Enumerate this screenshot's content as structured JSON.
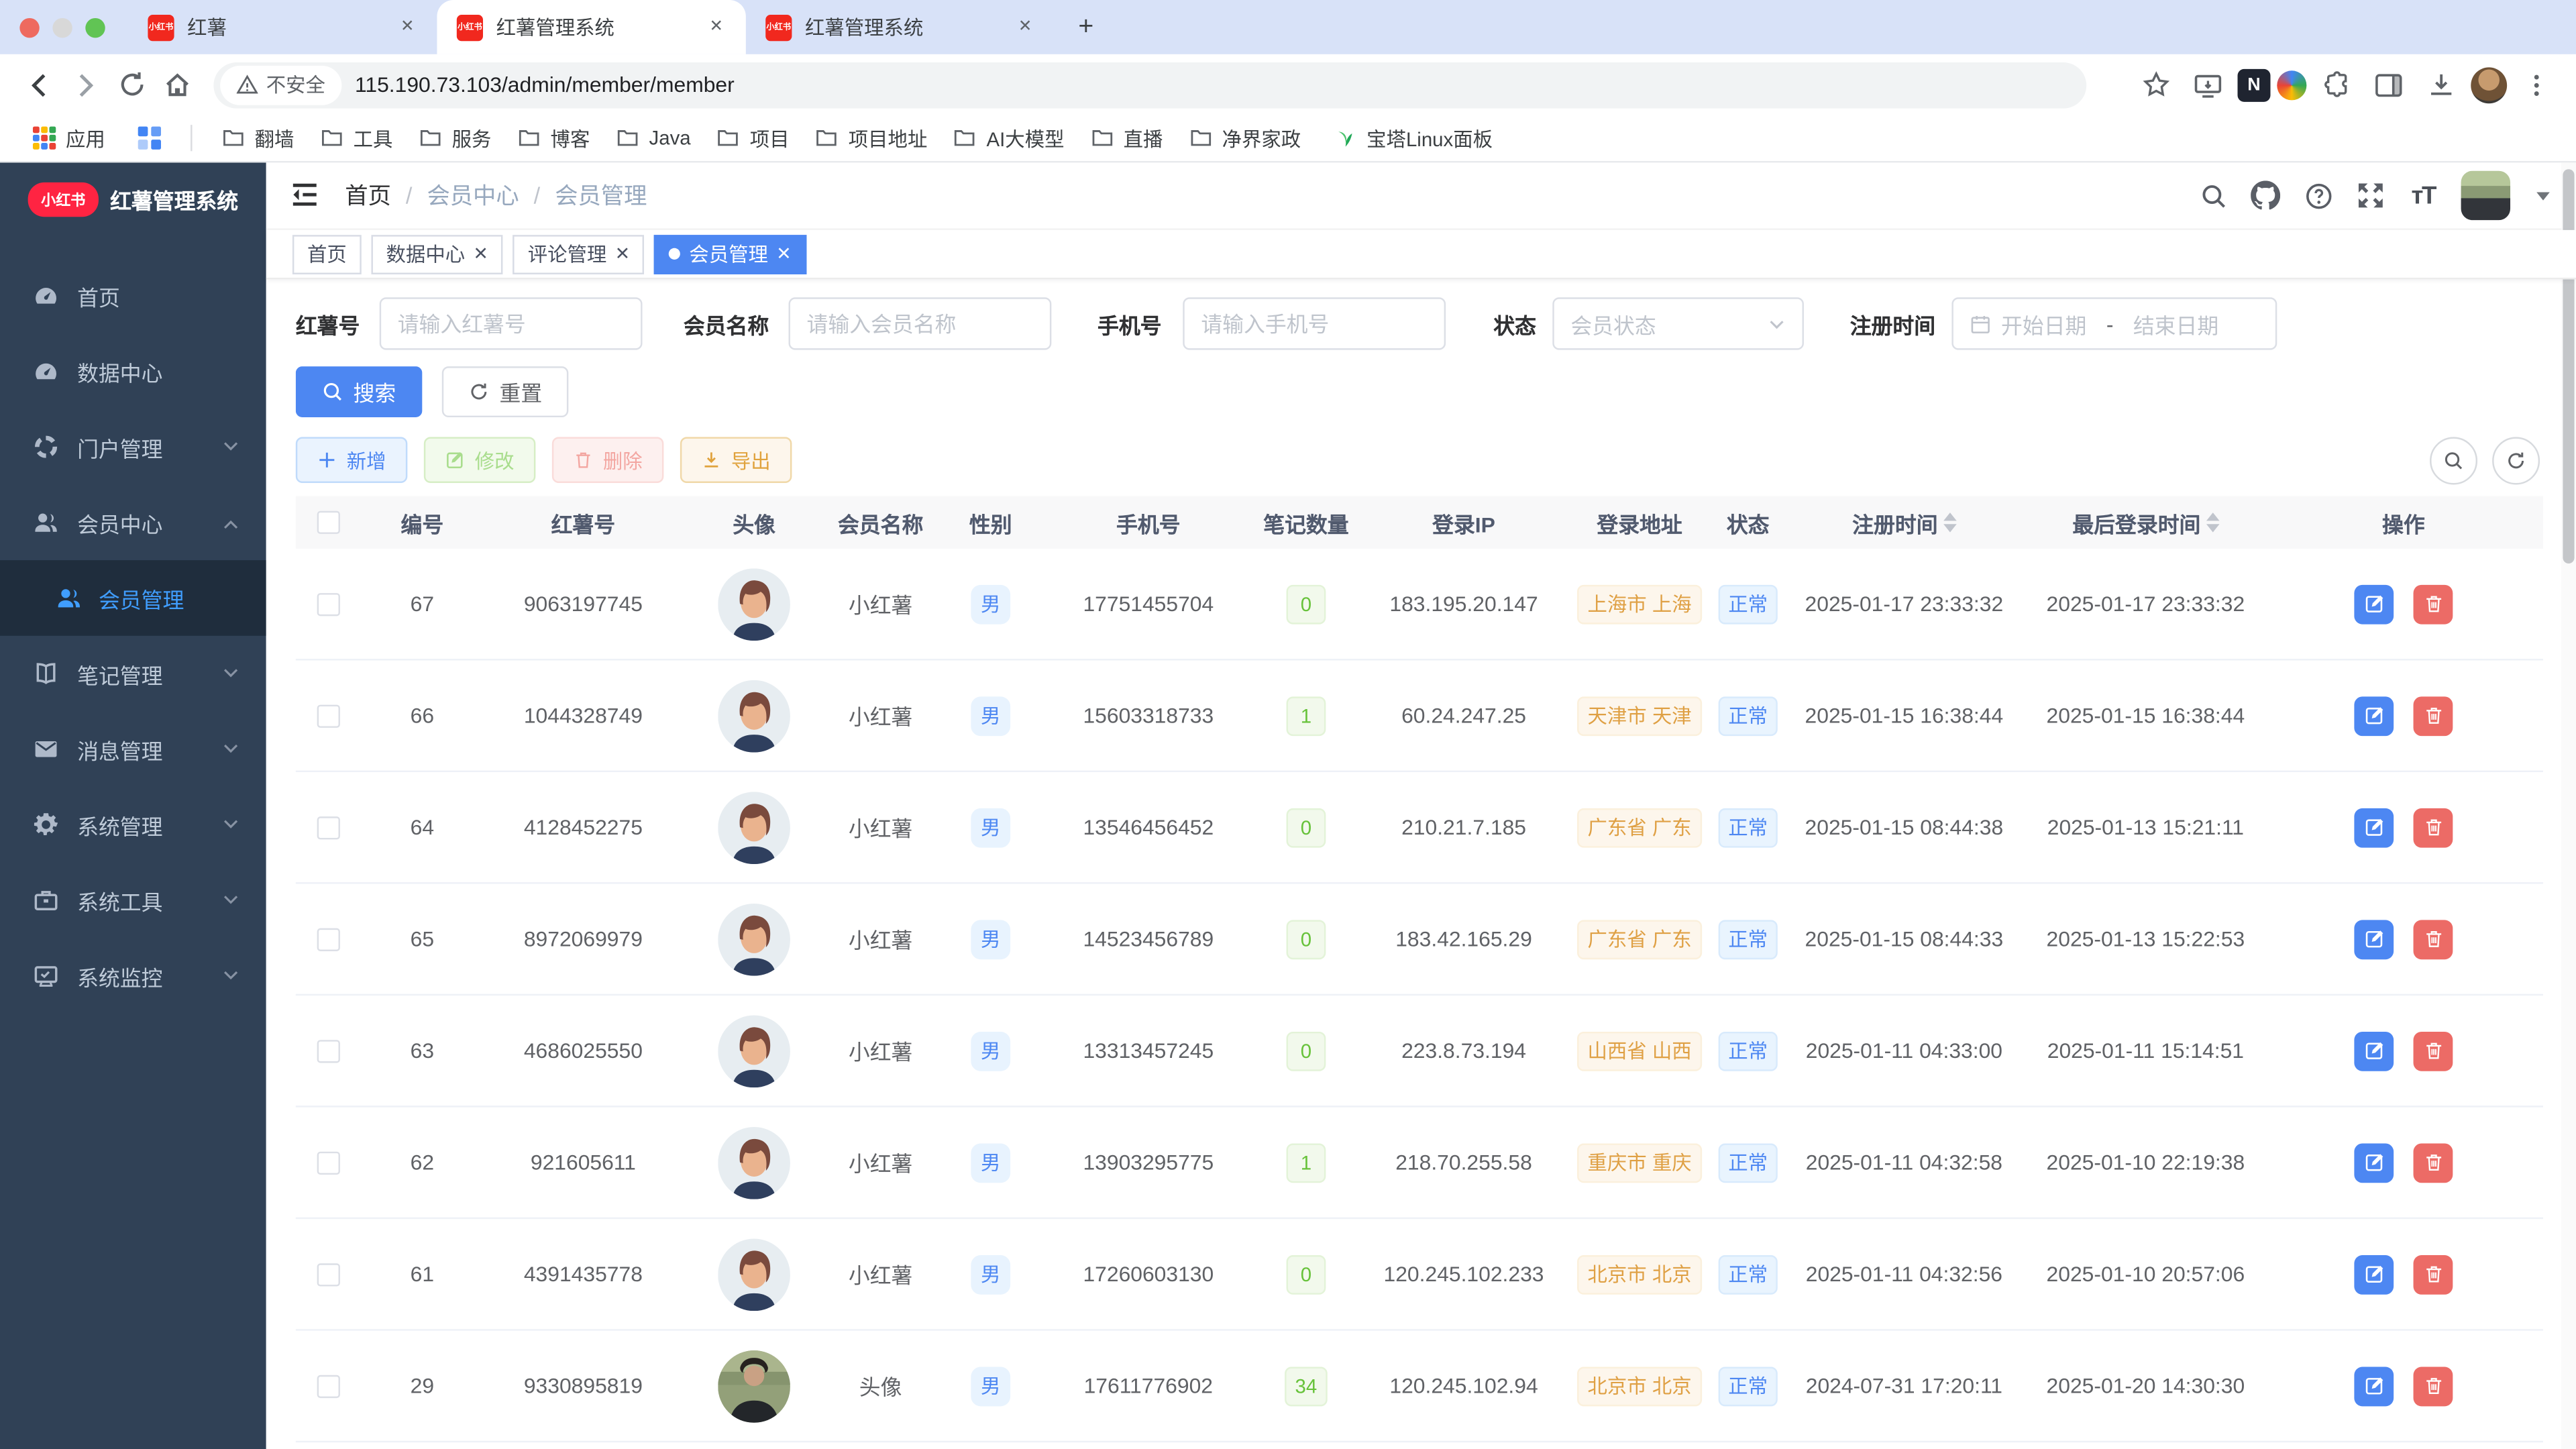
{
  "browser": {
    "tabs": [
      {
        "title": "红薯",
        "active": false
      },
      {
        "title": "红薯管理系统",
        "active": true
      },
      {
        "title": "红薯管理系统",
        "active": false
      }
    ],
    "favicon_text": "小红书",
    "security_label": "不安全",
    "url": "115.190.73.103/admin/member/member",
    "profile_badge": "N",
    "apps_label": "应用",
    "bookmarks": [
      "翻墙",
      "工具",
      "服务",
      "博客",
      "Java",
      "项目",
      "项目地址",
      "AI大模型",
      "直播",
      "净界家政"
    ],
    "bookmark_last": "宝塔Linux面板"
  },
  "sidebar": {
    "logo_badge": "小红书",
    "app_title": "红薯管理系统",
    "menu": [
      {
        "label": "首页",
        "icon": "dashboard",
        "chevron": ""
      },
      {
        "label": "数据中心",
        "icon": "dashboard",
        "chevron": ""
      },
      {
        "label": "门户管理",
        "icon": "portal",
        "chevron": "down"
      },
      {
        "label": "会员中心",
        "icon": "users",
        "chevron": "up"
      },
      {
        "label": "会员管理",
        "icon": "users",
        "chevron": "",
        "submenu": true,
        "active": true
      },
      {
        "label": "笔记管理",
        "icon": "book",
        "chevron": "down"
      },
      {
        "label": "消息管理",
        "icon": "mail",
        "chevron": "down"
      },
      {
        "label": "系统管理",
        "icon": "gear",
        "chevron": "down"
      },
      {
        "label": "系统工具",
        "icon": "briefcase",
        "chevron": "down"
      },
      {
        "label": "系统监控",
        "icon": "monitor",
        "chevron": "down"
      }
    ]
  },
  "navbar": {
    "breadcrumb": [
      "首页",
      "会员中心",
      "会员管理"
    ]
  },
  "tags": [
    {
      "label": "首页",
      "closable": false,
      "active": false
    },
    {
      "label": "数据中心",
      "closable": true,
      "active": false
    },
    {
      "label": "评论管理",
      "closable": true,
      "active": false
    },
    {
      "label": "会员管理",
      "closable": true,
      "active": true
    }
  ],
  "filters": {
    "redid_label": "红薯号",
    "redid_placeholder": "请输入红薯号",
    "name_label": "会员名称",
    "name_placeholder": "请输入会员名称",
    "phone_label": "手机号",
    "phone_placeholder": "请输入手机号",
    "status_label": "状态",
    "status_placeholder": "会员状态",
    "regtime_label": "注册时间",
    "date_start_placeholder": "开始日期",
    "date_separator": "-",
    "date_end_placeholder": "结束日期",
    "search_label": "搜索",
    "reset_label": "重置"
  },
  "toolbar": {
    "add_label": "新增",
    "edit_label": "修改",
    "delete_label": "删除",
    "export_label": "导出"
  },
  "table": {
    "columns": [
      "编号",
      "红薯号",
      "头像",
      "会员名称",
      "性别",
      "手机号",
      "笔记数量",
      "登录IP",
      "登录地址",
      "状态",
      "注册时间",
      "最后登录时间",
      "操作"
    ],
    "sortable_columns": [
      "注册时间",
      "最后登录时间"
    ],
    "rows": [
      {
        "id": "67",
        "account": "9063197745",
        "avatar": "cartoon",
        "name": "小红薯",
        "gender": "男",
        "phone": "17751455704",
        "notes": "0",
        "ip": "183.195.20.147",
        "location": "上海市 上海",
        "status": "正常",
        "reg_time": "2025-01-17 23:33:32",
        "last_login": "2025-01-17 23:33:32"
      },
      {
        "id": "66",
        "account": "1044328749",
        "avatar": "cartoon",
        "name": "小红薯",
        "gender": "男",
        "phone": "15603318733",
        "notes": "1",
        "ip": "60.24.247.25",
        "location": "天津市 天津",
        "status": "正常",
        "reg_time": "2025-01-15 16:38:44",
        "last_login": "2025-01-15 16:38:44"
      },
      {
        "id": "64",
        "account": "4128452275",
        "avatar": "cartoon",
        "name": "小红薯",
        "gender": "男",
        "phone": "13546456452",
        "notes": "0",
        "ip": "210.21.7.185",
        "location": "广东省 广东",
        "status": "正常",
        "reg_time": "2025-01-15 08:44:38",
        "last_login": "2025-01-13 15:21:11"
      },
      {
        "id": "65",
        "account": "8972069979",
        "avatar": "cartoon",
        "name": "小红薯",
        "gender": "男",
        "phone": "14523456789",
        "notes": "0",
        "ip": "183.42.165.29",
        "location": "广东省 广东",
        "status": "正常",
        "reg_time": "2025-01-15 08:44:33",
        "last_login": "2025-01-13 15:22:53"
      },
      {
        "id": "63",
        "account": "4686025550",
        "avatar": "cartoon",
        "name": "小红薯",
        "gender": "男",
        "phone": "13313457245",
        "notes": "0",
        "ip": "223.8.73.194",
        "location": "山西省 山西",
        "status": "正常",
        "reg_time": "2025-01-11 04:33:00",
        "last_login": "2025-01-11 15:14:51"
      },
      {
        "id": "62",
        "account": "921605611",
        "avatar": "cartoon",
        "name": "小红薯",
        "gender": "男",
        "phone": "13903295775",
        "notes": "1",
        "ip": "218.70.255.58",
        "location": "重庆市 重庆",
        "status": "正常",
        "reg_time": "2025-01-11 04:32:58",
        "last_login": "2025-01-10 22:19:38"
      },
      {
        "id": "61",
        "account": "4391435778",
        "avatar": "cartoon",
        "name": "小红薯",
        "gender": "男",
        "phone": "17260603130",
        "notes": "0",
        "ip": "120.245.102.233",
        "location": "北京市 北京",
        "status": "正常",
        "reg_time": "2025-01-11 04:32:56",
        "last_login": "2025-01-10 20:57:06"
      },
      {
        "id": "29",
        "account": "9330895819",
        "avatar": "photo",
        "name": "头像",
        "gender": "男",
        "phone": "17611776902",
        "notes": "34",
        "ip": "120.245.102.94",
        "location": "北京市 北京",
        "status": "正常",
        "reg_time": "2024-07-31 17:20:11",
        "last_login": "2025-01-20 14:30:30"
      }
    ]
  },
  "colors": {
    "primary": "#4d87f2",
    "sidebar_bg": "#304156",
    "submenu_bg": "#1f2d3d",
    "active_link": "#409eff",
    "danger": "#ec6b66",
    "success": "#67c23a",
    "warning": "#e0a23c",
    "tabbar_bg": "#d8e2f8",
    "xhs_red": "#ff2442"
  }
}
